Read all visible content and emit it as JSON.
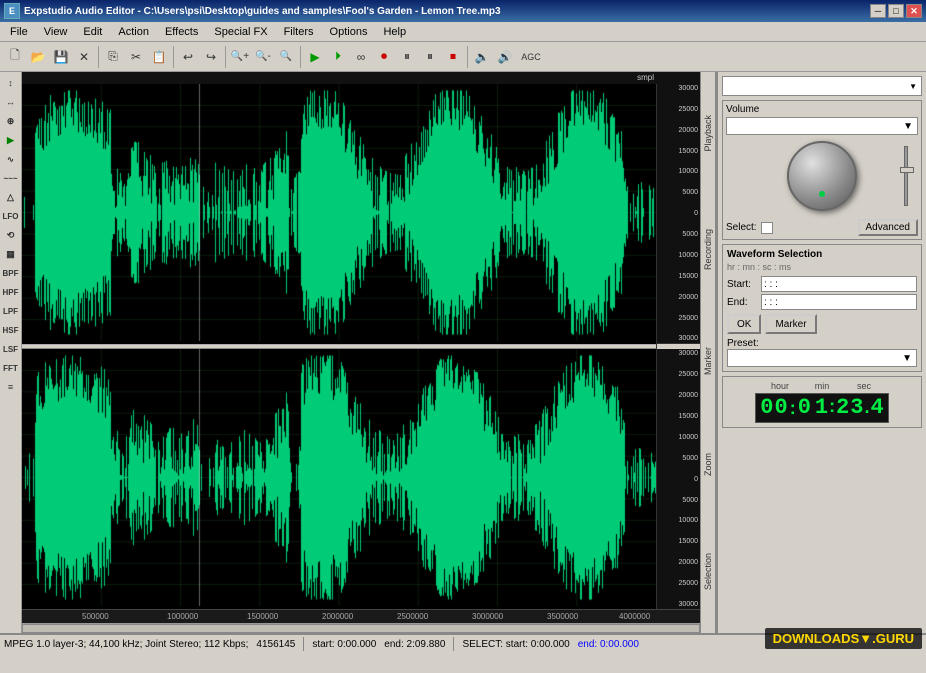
{
  "titleBar": {
    "title": "Expstudio Audio Editor - C:\\Users\\psi\\Desktop\\guides and samples\\Fool's Garden - Lemon Tree.mp3",
    "minimize": "─",
    "maximize": "□",
    "close": "✕"
  },
  "menuBar": {
    "items": [
      "File",
      "View",
      "Edit",
      "Action",
      "Effects",
      "Special FX",
      "Filters",
      "Options",
      "Help"
    ]
  },
  "toolbar": {
    "buttons": [
      "🗋",
      "📂",
      "💾",
      "✕",
      "📋",
      "✂",
      "📋",
      "↩",
      "↪",
      "🔍+",
      "🔍-",
      "🔍",
      "▶",
      "⏵",
      "∞",
      "⏺",
      "⏸",
      "⏸",
      "⏹",
      "⏮",
      "🔊",
      "AGC"
    ]
  },
  "leftTools": {
    "items": [
      "↕",
      "↔",
      "⊕",
      "▶",
      "∿",
      "~~~",
      "▲",
      "LFO",
      "⟲",
      "▦",
      "BPF",
      "HPF",
      "LPF",
      "HSF",
      "LSF",
      "FFT",
      "≡"
    ]
  },
  "waveform": {
    "smplLabel": "smpl",
    "channel1": {
      "scales": [
        "30000",
        "25000",
        "20000",
        "15000",
        "10000",
        "5000",
        "0",
        "5000",
        "10000",
        "15000",
        "20000",
        "25000",
        "30000"
      ]
    },
    "channel2": {
      "scales": [
        "30000",
        "25000",
        "20000",
        "15000",
        "10000",
        "5000",
        "0",
        "5000",
        "10000",
        "15000",
        "20000",
        "25000",
        "30000"
      ]
    },
    "rulerLabels": [
      "500000",
      "1000000",
      "1500000",
      "2000000",
      "2500000",
      "3000000",
      "3500000",
      "4000000"
    ]
  },
  "rightPanel": {
    "topDropdown": "",
    "volumeSection": {
      "title": "Volume",
      "dropdown": ""
    },
    "selectLabel": "Select:",
    "advancedLabel": "Advanced",
    "playbackTab": "Playback",
    "recordingTab": "Recording",
    "markerTab": "Marker",
    "zoomTab": "Zoom",
    "selectionTab": "Selection",
    "waveformSelection": {
      "title": "Waveform Selection",
      "subtitle": "hr : mn : sc : ms",
      "startLabel": "Start:",
      "startValue": ": : :",
      "endLabel": "End:",
      "endValue": ": : :",
      "okLabel": "OK",
      "markerLabel": "Marker",
      "presetLabel": "Preset:"
    },
    "timeDisplay": {
      "hourLabel": "hour",
      "minLabel": "min",
      "secLabel": "sec",
      "digits": "00:0 1:23.4"
    }
  },
  "statusBar": {
    "format": "MPEG 1.0 layer-3; 44,100 kHz; Joint Stereo; 112 Kbps;",
    "filesize": "4156145",
    "start": "start: 0:00.000",
    "end": "end: 2:09.880",
    "select": "SELECT: start: 0:00.000",
    "selectEnd": "end: 0:00.000",
    "selectEndColor": "#0000ff"
  }
}
